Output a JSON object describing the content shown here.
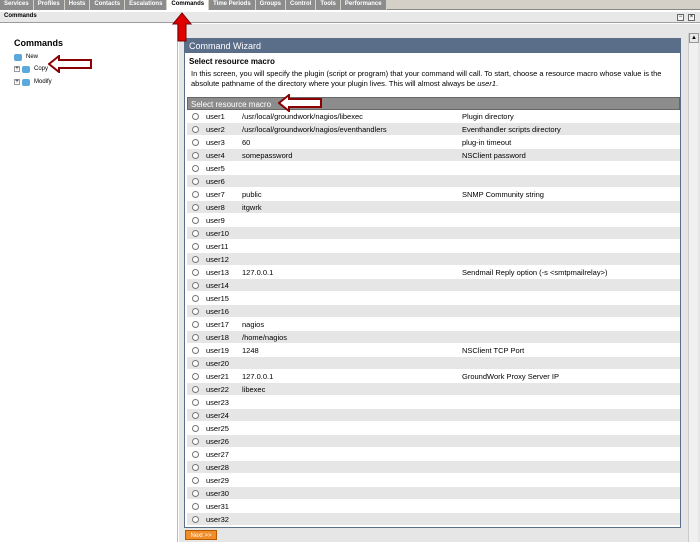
{
  "tabs": [
    "Services",
    "Profiles",
    "Hosts",
    "Contacts",
    "Escalations",
    "Commands",
    "Time Periods",
    "Groups",
    "Control",
    "Tools",
    "Performance"
  ],
  "active_tab": "Commands",
  "section": {
    "title": "Commands"
  },
  "left": {
    "title": "Commands",
    "items": [
      {
        "label": "New",
        "expander": ""
      },
      {
        "label": "Copy",
        "expander": "+"
      },
      {
        "label": "Modify",
        "expander": "+"
      }
    ]
  },
  "wizard": {
    "title": "Command Wizard",
    "heading": "Select resource macro",
    "description": "In this screen, you will specify the plugin (script or program) that your command will call. To start, choose a resource macro whose value is the absolute pathname of the directory where your plugin lives. This will almost always be ",
    "description_em": "user1",
    "description_end": ".",
    "table_header": "Select resource macro",
    "next_label": "Next >>"
  },
  "macros": [
    {
      "name": "user1",
      "value": "/usr/local/groundwork/nagios/libexec",
      "desc": "Plugin directory"
    },
    {
      "name": "user2",
      "value": "/usr/local/groundwork/nagios/eventhandlers",
      "desc": "Eventhandler scripts directory"
    },
    {
      "name": "user3",
      "value": "60",
      "desc": "plug-in timeout"
    },
    {
      "name": "user4",
      "value": "somepassword",
      "desc": "NSClient password"
    },
    {
      "name": "user5",
      "value": "",
      "desc": ""
    },
    {
      "name": "user6",
      "value": "",
      "desc": ""
    },
    {
      "name": "user7",
      "value": "public",
      "desc": "SNMP Community string"
    },
    {
      "name": "user8",
      "value": "itgwrk",
      "desc": ""
    },
    {
      "name": "user9",
      "value": "",
      "desc": ""
    },
    {
      "name": "user10",
      "value": "",
      "desc": ""
    },
    {
      "name": "user11",
      "value": "",
      "desc": ""
    },
    {
      "name": "user12",
      "value": "",
      "desc": ""
    },
    {
      "name": "user13",
      "value": "127.0.0.1",
      "desc": "Sendmail Reply option (-s <smtpmailrelay>)"
    },
    {
      "name": "user14",
      "value": "",
      "desc": ""
    },
    {
      "name": "user15",
      "value": "",
      "desc": ""
    },
    {
      "name": "user16",
      "value": "",
      "desc": ""
    },
    {
      "name": "user17",
      "value": "nagios",
      "desc": ""
    },
    {
      "name": "user18",
      "value": "/home/nagios",
      "desc": ""
    },
    {
      "name": "user19",
      "value": "1248",
      "desc": "NSClient TCP Port"
    },
    {
      "name": "user20",
      "value": "",
      "desc": ""
    },
    {
      "name": "user21",
      "value": "127.0.0.1",
      "desc": "GroundWork Proxy Server IP"
    },
    {
      "name": "user22",
      "value": "libexec",
      "desc": ""
    },
    {
      "name": "user23",
      "value": "",
      "desc": ""
    },
    {
      "name": "user24",
      "value": "",
      "desc": ""
    },
    {
      "name": "user25",
      "value": "",
      "desc": ""
    },
    {
      "name": "user26",
      "value": "",
      "desc": ""
    },
    {
      "name": "user27",
      "value": "",
      "desc": ""
    },
    {
      "name": "user28",
      "value": "",
      "desc": ""
    },
    {
      "name": "user29",
      "value": "",
      "desc": ""
    },
    {
      "name": "user30",
      "value": "",
      "desc": ""
    },
    {
      "name": "user31",
      "value": "",
      "desc": ""
    },
    {
      "name": "user32",
      "value": "",
      "desc": ""
    }
  ],
  "window_buttons": {
    "minimize": "−",
    "close": "×",
    "scroll_up": "▲"
  },
  "colors": {
    "accent": "#5a6e8a",
    "next_button": "#f28c28",
    "annotation_arrow": "#8b0000",
    "annotation_arrow_up": "#e00000"
  }
}
